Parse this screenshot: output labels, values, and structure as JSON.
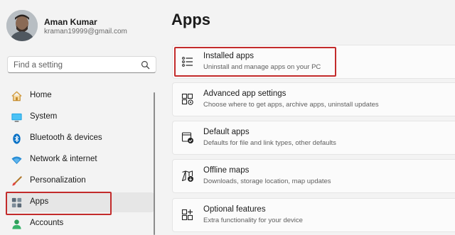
{
  "profile": {
    "name": "Aman Kumar",
    "email": "kraman19999@gmail.com"
  },
  "search": {
    "placeholder": "Find a setting",
    "value": ""
  },
  "sidebar": {
    "items": [
      {
        "label": "Home",
        "icon": "home-icon"
      },
      {
        "label": "System",
        "icon": "monitor-icon"
      },
      {
        "label": "Bluetooth & devices",
        "icon": "bluetooth-icon"
      },
      {
        "label": "Network & internet",
        "icon": "wifi-icon"
      },
      {
        "label": "Personalization",
        "icon": "brush-icon"
      },
      {
        "label": "Apps",
        "icon": "apps-icon",
        "selected": true
      },
      {
        "label": "Accounts",
        "icon": "person-icon"
      }
    ]
  },
  "page": {
    "title": "Apps"
  },
  "cards": [
    {
      "title": "Installed apps",
      "subtitle": "Uninstall and manage apps on your PC",
      "icon": "list-icon"
    },
    {
      "title": "Advanced app settings",
      "subtitle": "Choose where to get apps, archive apps, uninstall updates",
      "icon": "app-settings-icon"
    },
    {
      "title": "Default apps",
      "subtitle": "Defaults for file and link types, other defaults",
      "icon": "default-apps-icon"
    },
    {
      "title": "Offline maps",
      "subtitle": "Downloads, storage location, map updates",
      "icon": "map-download-icon"
    },
    {
      "title": "Optional features",
      "subtitle": "Extra functionality for your device",
      "icon": "add-feature-icon"
    }
  ],
  "colors": {
    "highlight": "#c32b2b",
    "accent": "#0067c0"
  }
}
